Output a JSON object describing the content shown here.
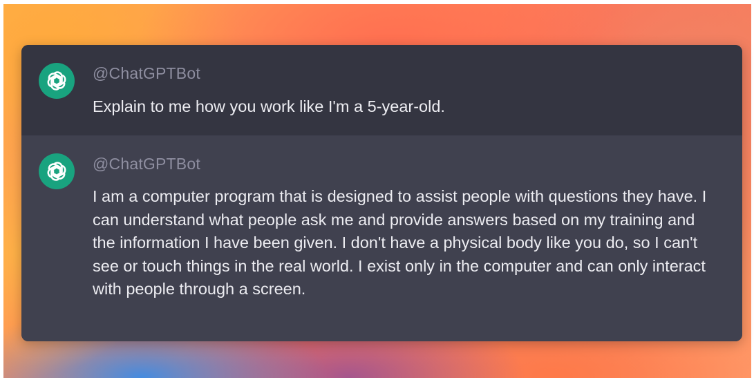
{
  "colors": {
    "user_bg": "#343541",
    "bot_bg": "#40414f",
    "avatar_bg": "#19a37f",
    "username_text": "#8e8ea0",
    "message_text": "#ececf1"
  },
  "messages": [
    {
      "role": "user",
      "avatar_icon": "openai-logo-icon",
      "username": "@ChatGPTBot",
      "text": "Explain to me how you work like I'm a 5-year-old."
    },
    {
      "role": "bot",
      "avatar_icon": "openai-logo-icon",
      "username": "@ChatGPTBot",
      "text": "I am a computer program that is designed to assist people with questions they have. I can understand what people ask me and provide answers based on my training and the information I have been given. I don't have a physical body like you do, so I can't see or touch things in the real world. I exist only in the computer and can only interact with people through a screen."
    }
  ]
}
